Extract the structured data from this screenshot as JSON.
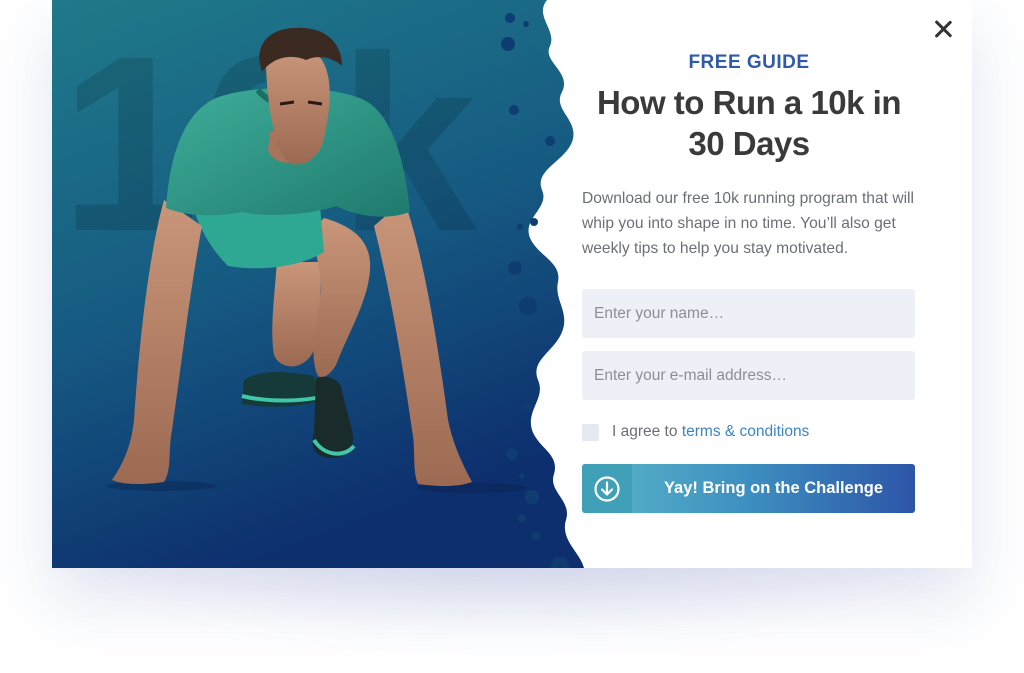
{
  "colors": {
    "kicker": "#2f5aa8",
    "headline": "#3a3a3a",
    "link": "#3d84c4",
    "hero_gradient_top": "#1f7a8a",
    "hero_gradient_bottom": "#0d2f6e",
    "cta_gradient_start": "#5ab6c9",
    "cta_gradient_end": "#2d55a8"
  },
  "hero": {
    "background_text": "10k",
    "image": "runner-in-start-position"
  },
  "popup": {
    "close_icon": "close-icon",
    "kicker": "FREE GUIDE",
    "headline": "How to Run a 10k in 30 Days",
    "description": "Download our free 10k running program that will whip you into shape in no time. You’ll also get weekly tips to help you stay motivated.",
    "form": {
      "name_placeholder": "Enter your name…",
      "name_value": "",
      "email_placeholder": "Enter your e-mail address…",
      "email_value": "",
      "agree_prefix": "I agree to",
      "terms_link": "terms & conditions",
      "agree_checked": false,
      "submit_label": "Yay! Bring on the Challenge",
      "submit_icon": "download-arrow-icon"
    }
  }
}
